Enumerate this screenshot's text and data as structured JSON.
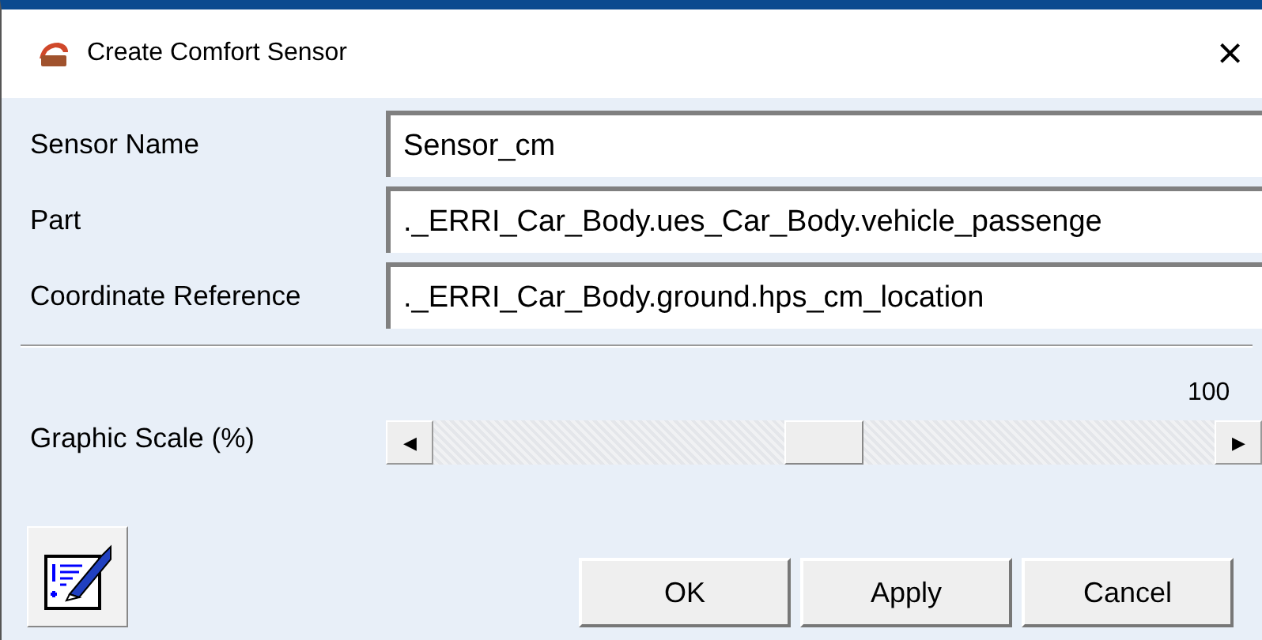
{
  "window": {
    "title": "Create Comfort Sensor",
    "close": "×"
  },
  "fields": [
    {
      "label": "Sensor Name",
      "value": "Sensor_cm"
    },
    {
      "label": "Part",
      "value": "._ERRI_Car_Body.ues_Car_Body.vehicle_passenge"
    },
    {
      "label": "Coordinate Reference",
      "value": "._ERRI_Car_Body.ground.hps_cm_location"
    }
  ],
  "slider": {
    "label": "Graphic Scale (%)",
    "reading": "100",
    "level": 0.5,
    "left": "◀",
    "right": "▶"
  },
  "buttons": [
    "OK",
    "Apply",
    "Cancel"
  ]
}
